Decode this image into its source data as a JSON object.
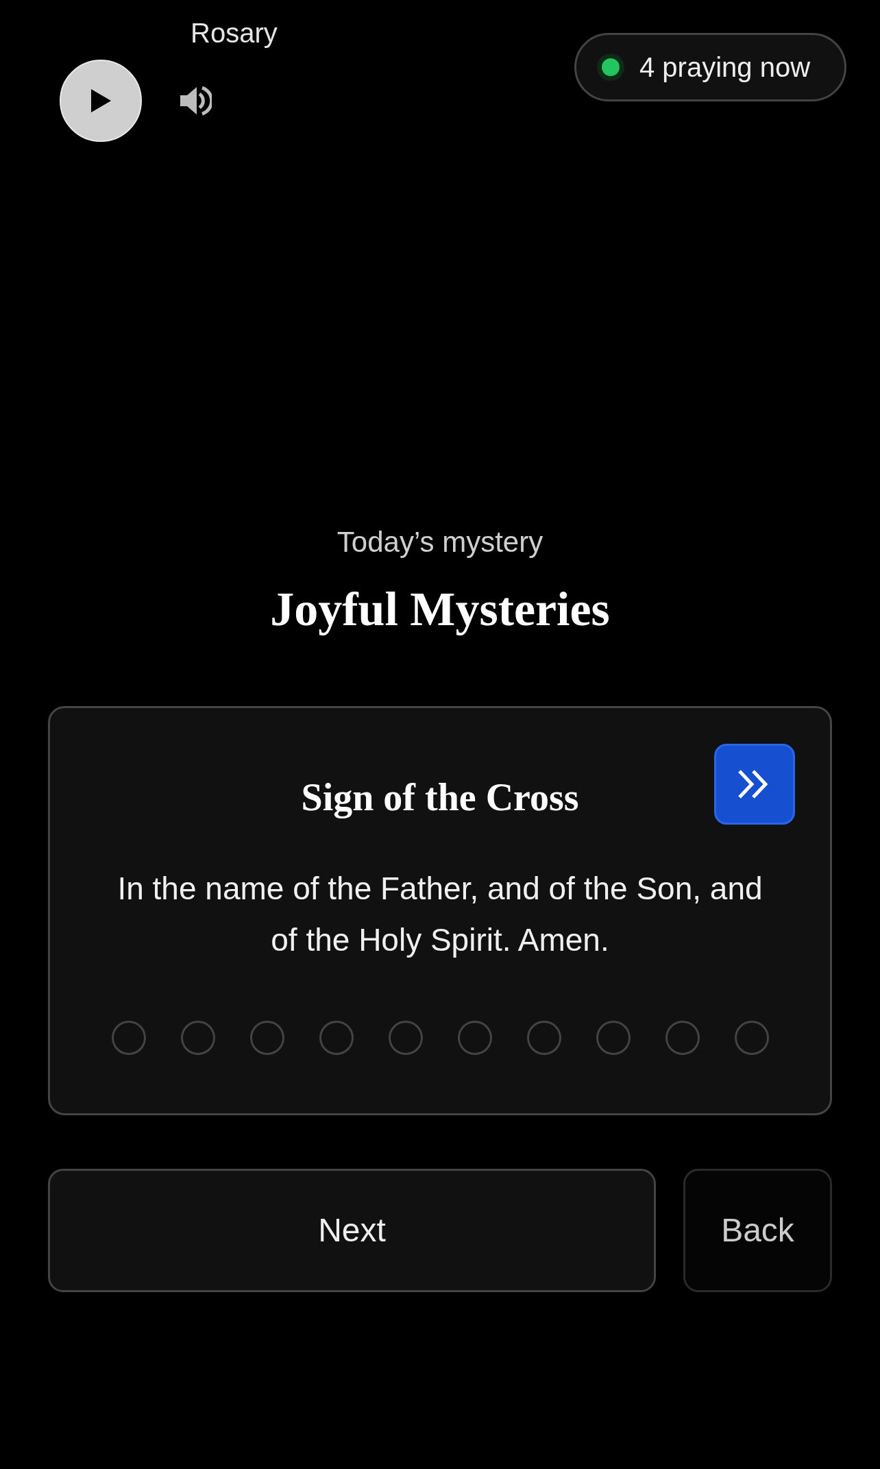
{
  "breadcrumb": {
    "current": "Rosary"
  },
  "presence": {
    "text": "4 praying now",
    "color": "#22c55e"
  },
  "mystery": {
    "caption": "Today’s mystery",
    "title": "Joyful Mysteries"
  },
  "prayer": {
    "title": "Sign of the Cross",
    "text": "In the name of the Father, and of the Son, and of the Holy Spirit. Amen.",
    "beads": [
      {
        "filled": false
      },
      {
        "filled": false
      },
      {
        "filled": false
      },
      {
        "filled": false
      },
      {
        "filled": false
      },
      {
        "filled": false
      },
      {
        "filled": false
      },
      {
        "filled": false
      },
      {
        "filled": false
      },
      {
        "filled": false
      }
    ]
  },
  "buttons": [
    {
      "label": "Next",
      "kind": "primary"
    },
    {
      "label": "Back",
      "kind": "secondary"
    }
  ]
}
